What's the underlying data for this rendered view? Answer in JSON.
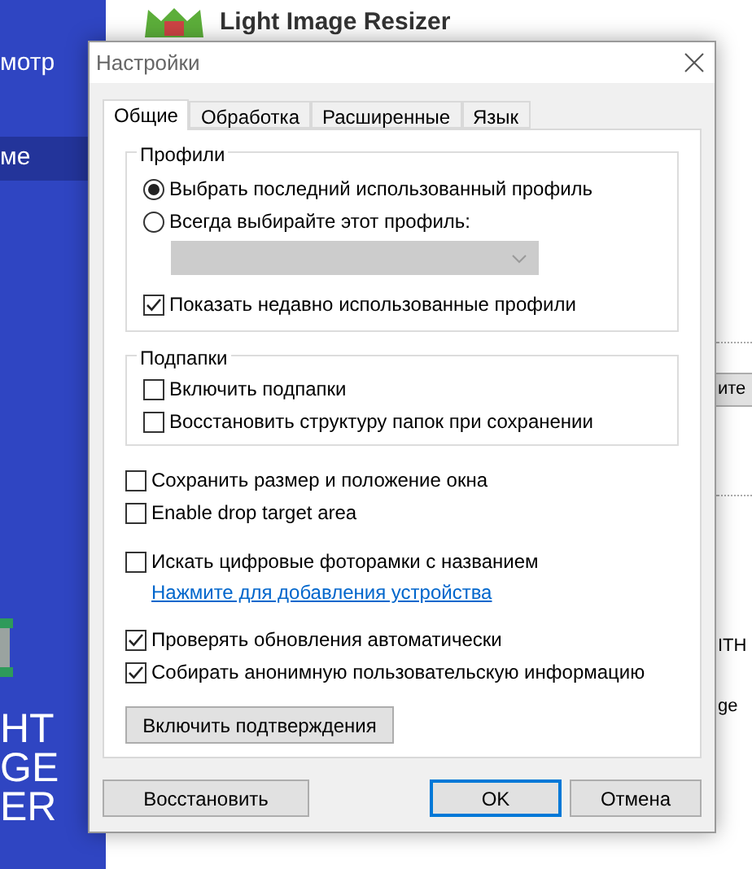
{
  "background": {
    "sidebar": {
      "items": [
        {
          "label": "мотр",
          "selected": false
        },
        {
          "label": "ме",
          "selected": true
        }
      ],
      "logo_lines": [
        "HT",
        "GE",
        "ER"
      ]
    },
    "app_title": "Light Image Resizer",
    "right_edge": {
      "button": "ите",
      "texts": [
        "ITH",
        "ge"
      ]
    }
  },
  "dialog": {
    "title": "Настройки",
    "tabs": [
      {
        "label": "Общие",
        "selected": true
      },
      {
        "label": "Обработка",
        "selected": false
      },
      {
        "label": "Расширенные",
        "selected": false
      },
      {
        "label": "Язык",
        "selected": false
      }
    ],
    "profiles": {
      "title": "Профили",
      "options": [
        {
          "label": "Выбрать последний использованный профиль",
          "selected": true
        },
        {
          "label": "Всегда выбирайте этот профиль:",
          "selected": false
        }
      ],
      "dropdown": {
        "disabled": true
      },
      "show_recent": {
        "label": "Показать недавно использованные профили",
        "checked": true
      }
    },
    "subfolders": {
      "title": "Подпапки",
      "options": [
        {
          "label": "Включить подпапки",
          "checked": false
        },
        {
          "label": "Восстановить структуру папок при сохранении",
          "checked": false
        }
      ]
    },
    "option_groups": [
      [
        {
          "kind": "checkbox",
          "label": "Сохранить размер и положение окна",
          "checked": false
        },
        {
          "kind": "checkbox",
          "label": "Enable drop target area",
          "checked": false
        }
      ],
      [
        {
          "kind": "checkbox",
          "label": "Искать цифровые фоторамки с названием",
          "checked": false
        },
        {
          "kind": "link",
          "label": "Нажмите для добавления устройства"
        }
      ],
      [
        {
          "kind": "checkbox",
          "label": "Проверять обновления автоматически",
          "checked": true
        },
        {
          "kind": "checkbox",
          "label": "Собирать анонимную пользовательскую информацию",
          "checked": true
        }
      ]
    ],
    "confirm_button": "Включить подтверждения",
    "buttons": [
      {
        "label": "Восстановить",
        "default": false
      },
      {
        "label": "OK",
        "default": true
      },
      {
        "label": "Отмена",
        "default": false
      }
    ]
  }
}
